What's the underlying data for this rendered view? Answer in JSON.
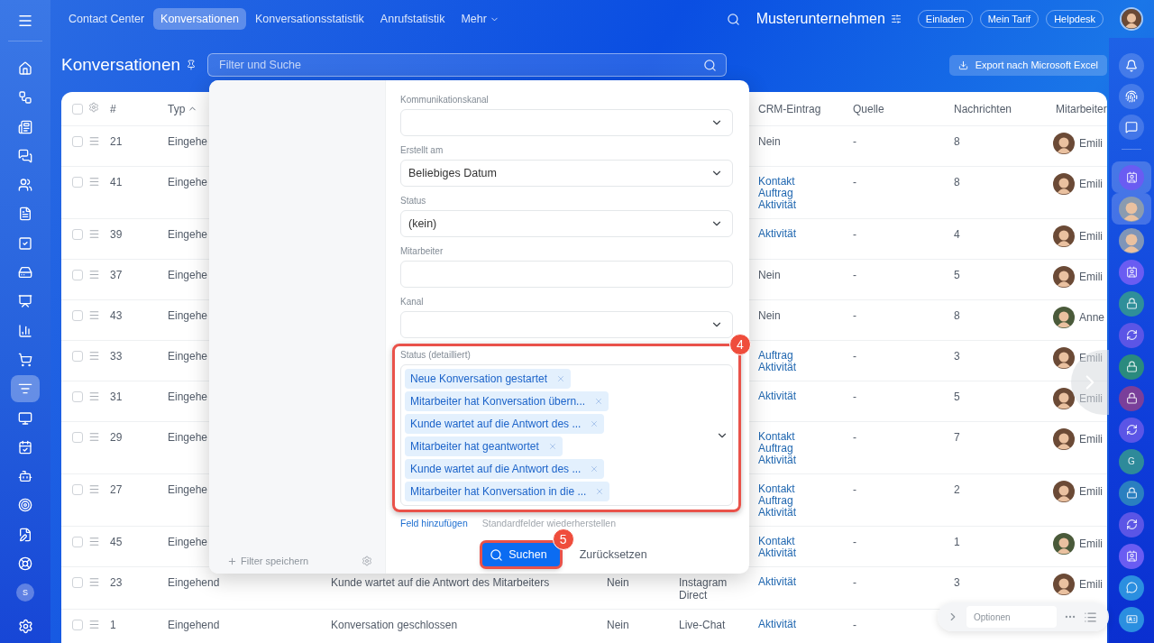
{
  "left_rail": {
    "items": [
      {
        "selected": false
      },
      {
        "selected": false
      },
      {
        "selected": false
      },
      {
        "selected": false
      },
      {
        "selected": false
      },
      {
        "selected": false
      },
      {
        "selected": false
      },
      {
        "selected": false
      },
      {
        "selected": false
      },
      {
        "selected": false
      },
      {
        "selected": false
      },
      {
        "selected": true
      },
      {
        "selected": false
      },
      {
        "selected": false
      },
      {
        "selected": false
      },
      {
        "selected": false
      },
      {
        "selected": false
      },
      {
        "selected": false
      }
    ],
    "user_initial": "S"
  },
  "top_nav": {
    "tabs": [
      {
        "label": "Contact Center",
        "selected": false,
        "kind": "link"
      },
      {
        "label": "Konversationen",
        "selected": true,
        "kind": "link"
      },
      {
        "label": "Konversationsstatistik",
        "selected": false,
        "kind": "link"
      },
      {
        "label": "Anrufstatistik",
        "selected": false,
        "kind": "link"
      },
      {
        "label": "Mehr",
        "selected": false,
        "kind": "menu"
      }
    ],
    "company": "Musterunternehmen",
    "buttons": [
      "Einladen",
      "Mein Tarif",
      "Helpdesk"
    ]
  },
  "page": {
    "title": "Konversationen",
    "search": {
      "placeholder": "Filter und Suche"
    },
    "export_button": "Export nach Microsoft Excel"
  },
  "table": {
    "header": {
      "select_all_checked": false,
      "number": {
        "label": "#"
      },
      "type": {
        "label": "Typ",
        "sorted_ascending": true
      },
      "crm": {
        "label": "CRM-Eintrag"
      },
      "source": {
        "label": "Quelle"
      },
      "messages": {
        "label": "Nachrichten"
      },
      "employee": {
        "label": "Mitarbeiter"
      }
    },
    "rows": [
      {
        "checked": false,
        "number": "21",
        "type": "Eingehe",
        "crm": [
          {
            "label": "Nein",
            "kind": "text"
          }
        ],
        "source": "-",
        "messages": "8",
        "employee": "Emili"
      },
      {
        "checked": false,
        "number": "41",
        "type": "Eingehe",
        "crm": [
          {
            "label": "Kontakt",
            "kind": "link"
          },
          {
            "label": "Auftrag",
            "kind": "link"
          },
          {
            "label": "Aktivität",
            "kind": "link"
          }
        ],
        "source": "-",
        "messages": "8",
        "employee": "Emili"
      },
      {
        "checked": false,
        "number": "39",
        "type": "Eingehe",
        "crm": [
          {
            "label": "Aktivität",
            "kind": "link"
          }
        ],
        "source": "-",
        "messages": "4",
        "employee": "Emili"
      },
      {
        "checked": false,
        "number": "37",
        "type": "Eingehe",
        "crm": [
          {
            "label": "Nein",
            "kind": "text"
          }
        ],
        "source": "-",
        "messages": "5",
        "employee": "Emili"
      },
      {
        "checked": false,
        "number": "43",
        "type": "Eingehe",
        "crm": [
          {
            "label": "Nein",
            "kind": "text"
          }
        ],
        "source": "-",
        "messages": "8",
        "employee": "Anne"
      },
      {
        "checked": false,
        "number": "33",
        "type": "Eingehe",
        "crm": [
          {
            "label": "Auftrag",
            "kind": "link"
          },
          {
            "label": "Aktivität",
            "kind": "link"
          }
        ],
        "source": "-",
        "messages": "3",
        "employee": "Emili"
      },
      {
        "checked": false,
        "number": "31",
        "type": "Eingehe",
        "crm": [
          {
            "label": "Aktivität",
            "kind": "link"
          }
        ],
        "source": "-",
        "messages": "5",
        "employee": "Emili"
      },
      {
        "checked": false,
        "number": "29",
        "type": "Eingehe",
        "crm": [
          {
            "label": "Kontakt",
            "kind": "link"
          },
          {
            "label": "Auftrag",
            "kind": "link"
          },
          {
            "label": "Aktivität",
            "kind": "link"
          }
        ],
        "source": "-",
        "messages": "7",
        "employee": "Emili"
      },
      {
        "checked": false,
        "number": "27",
        "type": "Eingehe",
        "crm": [
          {
            "label": "Kontakt",
            "kind": "link"
          },
          {
            "label": "Auftrag",
            "kind": "link"
          },
          {
            "label": "Aktivität",
            "kind": "link"
          }
        ],
        "source": "-",
        "messages": "2",
        "employee": "Emili"
      },
      {
        "checked": false,
        "number": "45",
        "type": "Eingehe",
        "crm": [
          {
            "label": "Kontakt",
            "kind": "link"
          },
          {
            "label": "Aktivität",
            "kind": "link"
          }
        ],
        "source": "-",
        "messages": "1",
        "employee": "Emili"
      },
      {
        "checked": false,
        "number": "23",
        "type": "Eingehend",
        "column_5": "Kunde wartet auf die Antwort des Mitarbeiters",
        "column_6": "Nein",
        "column_7": "Instagram Direct",
        "crm": [
          {
            "label": "Aktivität",
            "kind": "link"
          }
        ],
        "source": "-",
        "messages": "3",
        "employee": "Emili"
      },
      {
        "checked": false,
        "number": "1",
        "type": "Eingehend",
        "column_5": "Konversation geschlossen",
        "column_6": "Nein",
        "column_7": "Live-Chat",
        "crm": [
          {
            "label": "Aktivität",
            "kind": "link"
          }
        ],
        "source": "-"
      }
    ]
  },
  "filter_popup": {
    "save_filter": "Filter speichern",
    "fields": [
      {
        "label": "Kommunikationskanal",
        "kind": "select"
      },
      {
        "label": "Erstellt am",
        "kind": "select",
        "value": "Beliebiges Datum"
      },
      {
        "label": "Status",
        "kind": "select",
        "value": "(kein)"
      },
      {
        "label": "Mitarbeiter",
        "kind": "input"
      },
      {
        "label": "Kanal",
        "kind": "select"
      },
      {
        "label": "Status (detailliert)",
        "kind": "multiselect",
        "highlighted": true,
        "step": "4",
        "tags": [
          "Neue Konversation gestartet",
          "Mitarbeiter hat Konversation übern...",
          "Kunde wartet auf die Antwort des ...",
          "Mitarbeiter hat geantwortet",
          "Kunde wartet auf die Antwort des ...",
          "Mitarbeiter hat Konversation in die ..."
        ]
      }
    ],
    "add_field": "Feld hinzufügen",
    "restore_fields": "Standardfelder wiederherstellen",
    "search_button": {
      "label": "Suchen",
      "highlighted": true,
      "step": "5"
    },
    "reset_button": "Zurücksetzen"
  },
  "right_rail": {
    "chats": [
      {
        "kind": "contact",
        "color": "#6a5cf2",
        "selected": true
      },
      {
        "kind": "person",
        "color": "#8a9bb0",
        "selected": true
      },
      {
        "kind": "group",
        "color": "#7f95b8",
        "selected": false
      },
      {
        "kind": "contact",
        "color": "#6a5cf2",
        "selected": false
      },
      {
        "kind": "lock",
        "color": "#2f8f9a",
        "selected": false
      },
      {
        "kind": "refresh",
        "color": "#5b55e6",
        "selected": false
      },
      {
        "kind": "lock",
        "color": "#2a8a7e",
        "selected": false
      },
      {
        "kind": "lock",
        "color": "#7a3f9a",
        "selected": false
      },
      {
        "kind": "refresh",
        "color": "#5b55e6",
        "selected": false
      },
      {
        "kind": "letter",
        "color": "#2e8a9a",
        "label": "G",
        "selected": false
      },
      {
        "kind": "lock",
        "color": "#2a7fc0",
        "selected": false
      },
      {
        "kind": "refresh",
        "color": "#5b55e6",
        "selected": false
      },
      {
        "kind": "contact",
        "color": "#6a5cf2",
        "selected": false
      },
      {
        "kind": "chat",
        "color": "#2b8fe0",
        "selected": false
      },
      {
        "kind": "card",
        "color": "#2b8fe0",
        "selected": false
      }
    ]
  },
  "options_bar": {
    "label": "Optionen"
  }
}
